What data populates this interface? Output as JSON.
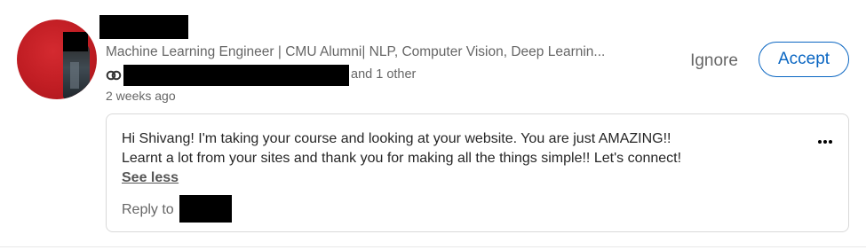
{
  "invitation": {
    "headline": "Machine Learning Engineer | CMU Alumni| NLP, Computer Vision, Deep Learnin...",
    "mutual_icon": "mutual-connections-icon",
    "mutual_other_text": "and 1 other",
    "timestamp": "2 weeks ago",
    "actions": {
      "ignore_label": "Ignore",
      "accept_label": "Accept"
    },
    "message": {
      "line1": "Hi Shivang! I'm taking your course and looking at your website. You are just AMAZING!!",
      "line2": "Learnt a lot from your sites and thank you for making all the things simple!! Let's connect!",
      "see_less_label": "See less",
      "reply_prefix": "Reply to",
      "more_icon": "more-options-icon"
    }
  },
  "colors": {
    "accent": "#0a66c2",
    "muted_text": "#666666",
    "body_text": "#262626",
    "avatar_bg": "#c01d23"
  }
}
